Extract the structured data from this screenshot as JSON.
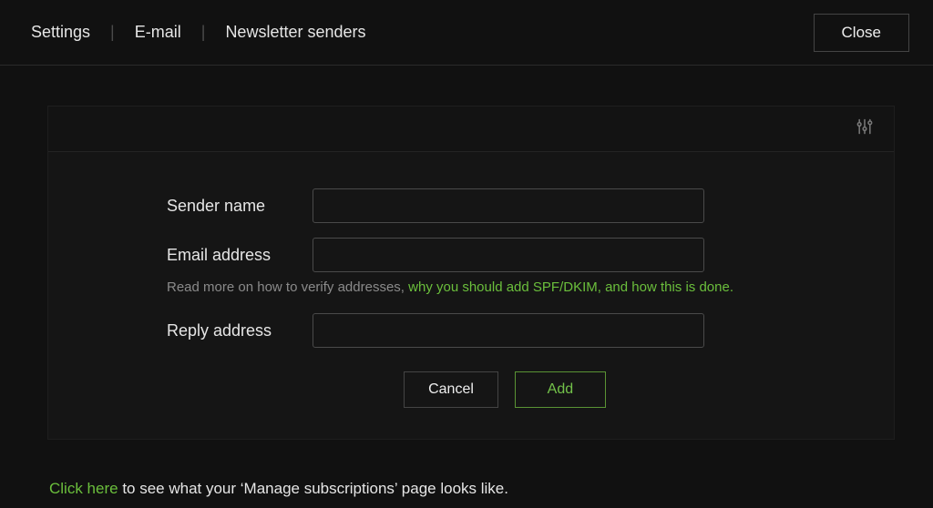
{
  "breadcrumb": [
    "Settings",
    "E-mail",
    "Newsletter senders"
  ],
  "close_label": "Close",
  "form": {
    "sender_name": {
      "label": "Sender name",
      "value": ""
    },
    "email_address": {
      "label": "Email address",
      "value": ""
    },
    "reply_address": {
      "label": "Reply address",
      "value": ""
    },
    "hint_prefix": "Read more on how to verify addresses, ",
    "hint_link": "why you should add SPF/DKIM, and how this is done.",
    "cancel_label": "Cancel",
    "add_label": "Add"
  },
  "footer": {
    "link_text": "Click here",
    "rest_text": " to see what your ‘Manage subscriptions’ page looks like."
  }
}
